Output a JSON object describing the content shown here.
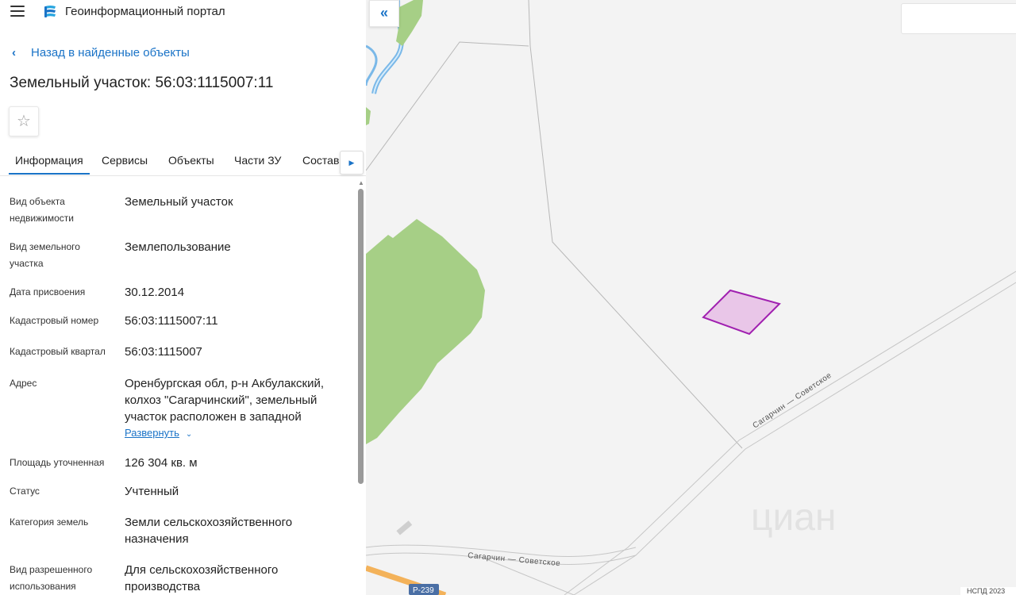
{
  "header": {
    "app_title": "Геоинформационный портал"
  },
  "nav": {
    "back_label": "Назад в найденные объекты"
  },
  "object": {
    "title": "Земельный участок: 56:03:1115007:11"
  },
  "tabs": [
    {
      "label": "Информация",
      "active": true
    },
    {
      "label": "Сервисы",
      "active": false
    },
    {
      "label": "Объекты",
      "active": false
    },
    {
      "label": "Части ЗУ",
      "active": false
    },
    {
      "label": "Состав",
      "active": false
    }
  ],
  "info": [
    {
      "label": "Вид объекта недвижимости",
      "value": "Земельный участок"
    },
    {
      "label": "Вид земельного участка",
      "value": "Землепользование"
    },
    {
      "label": "Дата присвоения",
      "value": "30.12.2014"
    },
    {
      "label": "Кадастровый номер",
      "value": "56:03:1115007:11"
    },
    {
      "label": "Кадастровый квартал",
      "value": "56:03:1115007"
    },
    {
      "label": "Адрес",
      "value": "Оренбургская обл, р-н Акбулакский, колхоз \"Сагарчинский\", земельный участок расположен в западной"
    },
    {
      "label": "Площадь уточненная",
      "value": "126 304 кв. м"
    },
    {
      "label": "Статус",
      "value": "Учтенный"
    },
    {
      "label": "Категория земель",
      "value": "Земли сельскохозяйственного назначения"
    },
    {
      "label": "Вид разрешенного использования",
      "value": "Для сельскохозяйственного производства"
    }
  ],
  "expand_label": "Развернуть",
  "map": {
    "road_label_1": "Сагарчин — Советское",
    "road_label_2": "Сагарчин — Советское",
    "route_badge": "Р-239",
    "watermark": "циан",
    "footer": "НСПД 2023",
    "colors": {
      "forest": "#a6cf86",
      "parcel_fill": "#e9c6e8",
      "parcel_stroke": "#a020b0",
      "water": "#7ab8e8",
      "road": "#f3b25a"
    }
  },
  "icons": [
    "menu-icon",
    "portal-logo-icon",
    "chevron-left-icon",
    "star-icon",
    "chevron-right-icon",
    "chevron-down-icon",
    "double-chevron-left-icon"
  ]
}
